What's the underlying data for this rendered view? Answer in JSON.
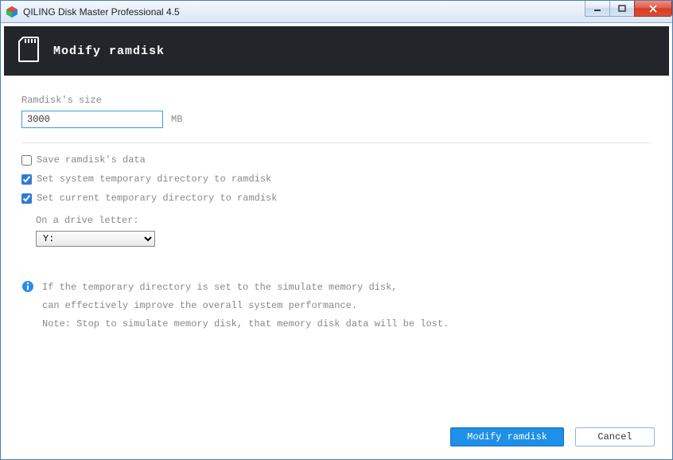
{
  "window": {
    "title": "QILING Disk Master Professional 4.5"
  },
  "header": {
    "title": "Modify ramdisk"
  },
  "form": {
    "size_label": "Ramdisk's size",
    "size_value": "3000",
    "size_unit": "MB",
    "cb_save_label": "Save ramdisk's data",
    "cb_save_checked": false,
    "cb_sys_tmp_label": "Set system temporary directory to ramdisk",
    "cb_sys_tmp_checked": true,
    "cb_cur_tmp_label": "Set current temporary directory to ramdisk",
    "cb_cur_tmp_checked": true,
    "drive_label": "On a drive letter:",
    "drive_value": "Y:"
  },
  "info": {
    "line1": "If the temporary directory is set to the simulate memory disk,",
    "line2": "can effectively improve the overall system performance.",
    "line3": "Note: Stop to simulate memory disk, that memory disk data will be lost."
  },
  "buttons": {
    "primary": "Modify ramdisk",
    "cancel": "Cancel"
  }
}
